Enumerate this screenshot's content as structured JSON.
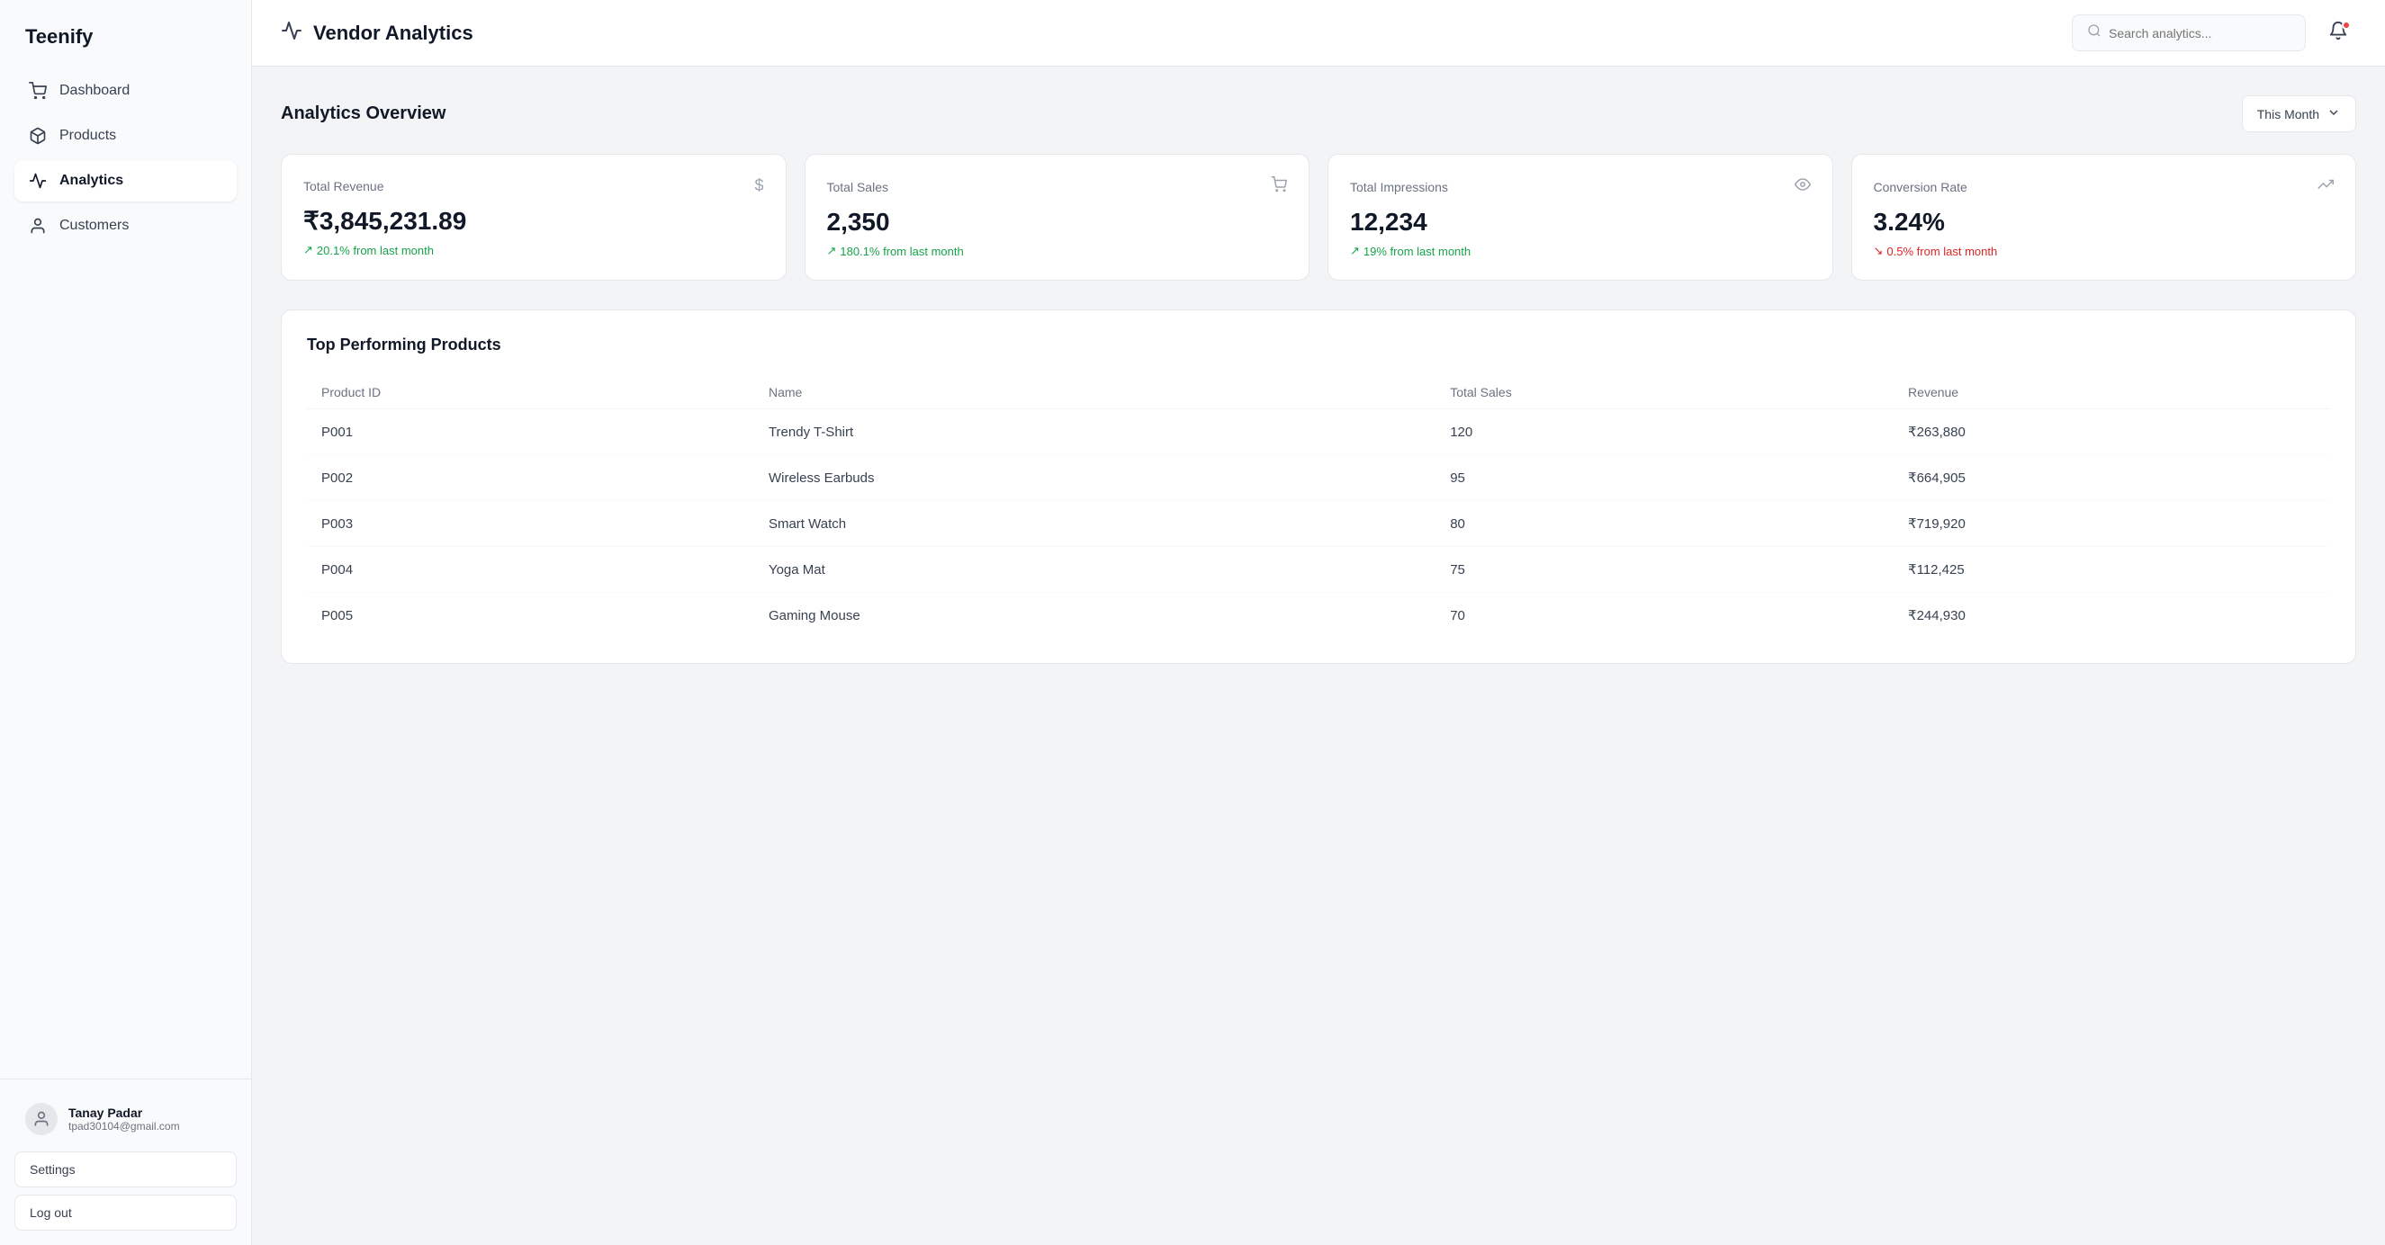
{
  "app": {
    "name": "Teenify"
  },
  "sidebar": {
    "nav_items": [
      {
        "id": "dashboard",
        "label": "Dashboard",
        "icon": "cart",
        "active": false
      },
      {
        "id": "products",
        "label": "Products",
        "icon": "box",
        "active": false
      },
      {
        "id": "analytics",
        "label": "Analytics",
        "icon": "chart",
        "active": true
      },
      {
        "id": "customers",
        "label": "Customers",
        "icon": "user",
        "active": false
      }
    ],
    "user": {
      "name": "Tanay Padar",
      "email": "tpad30104@gmail.com"
    },
    "settings_label": "Settings",
    "logout_label": "Log out"
  },
  "header": {
    "title": "Vendor Analytics",
    "search_placeholder": "Search analytics..."
  },
  "analytics": {
    "section_title": "Analytics Overview",
    "time_filter": "This Month",
    "cards": [
      {
        "label": "Total Revenue",
        "icon": "$",
        "value": "₹3,845,231.89",
        "change": "20.1% from last month",
        "positive": true
      },
      {
        "label": "Total Sales",
        "icon": "cart",
        "value": "2,350",
        "change": "180.1% from last month",
        "positive": true
      },
      {
        "label": "Total Impressions",
        "icon": "eye",
        "value": "12,234",
        "change": "19% from last month",
        "positive": true
      },
      {
        "label": "Conversion Rate",
        "icon": "arrow",
        "value": "3.24%",
        "change": "0.5% from last month",
        "positive": false
      }
    ],
    "table": {
      "title": "Top Performing Products",
      "columns": [
        "Product ID",
        "Name",
        "Total Sales",
        "Revenue"
      ],
      "rows": [
        {
          "id": "P001",
          "name": "Trendy T-Shirt",
          "sales": "120",
          "revenue": "₹263,880"
        },
        {
          "id": "P002",
          "name": "Wireless Earbuds",
          "sales": "95",
          "revenue": "₹664,905"
        },
        {
          "id": "P003",
          "name": "Smart Watch",
          "sales": "80",
          "revenue": "₹719,920"
        },
        {
          "id": "P004",
          "name": "Yoga Mat",
          "sales": "75",
          "revenue": "₹112,425"
        },
        {
          "id": "P005",
          "name": "Gaming Mouse",
          "sales": "70",
          "revenue": "₹244,930"
        }
      ]
    }
  }
}
